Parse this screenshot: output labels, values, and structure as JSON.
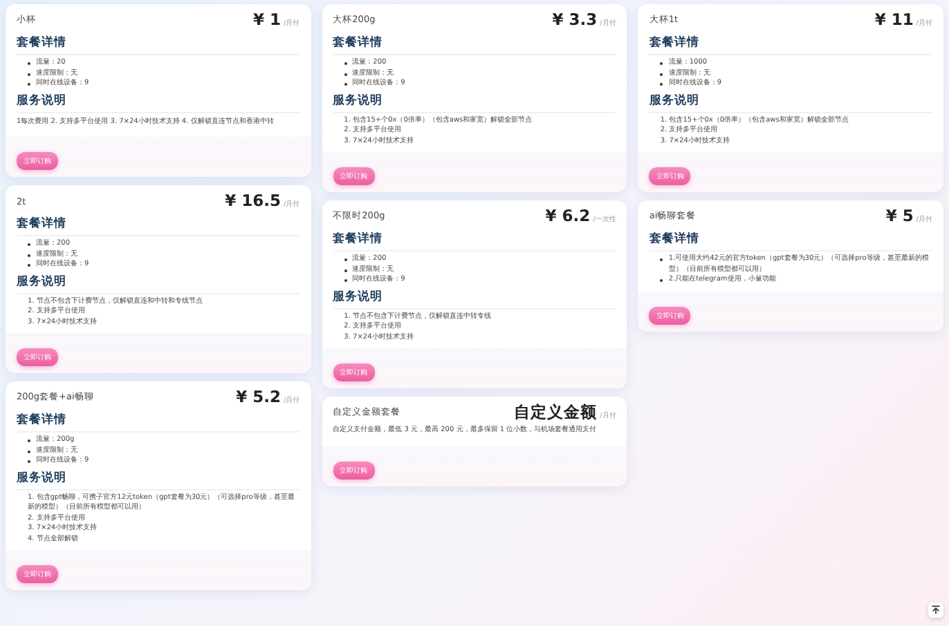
{
  "columns": [
    {
      "cards": [
        {
          "name": "小杯",
          "price": "¥ 1",
          "unit": "/月付",
          "button": "立即订购",
          "sections": [
            {
              "heading": "套餐详情",
              "kind": "bullets",
              "items": [
                "流量：20",
                "速度限制：无",
                "同时在线设备：9"
              ]
            },
            {
              "heading": "服务说明",
              "kind": "text",
              "text": "1每次费用 2. 支持多平台使用 3. 7×24小时技术支持 4. 仅解锁直连节点和香港中转"
            }
          ]
        },
        {
          "name": "2t",
          "price": "¥ 16.5",
          "unit": "/月付",
          "button": "立即订购",
          "sections": [
            {
              "heading": "套餐详情",
              "kind": "bullets",
              "items": [
                "流量：200",
                "速度限制：无",
                "同时在线设备：9"
              ]
            },
            {
              "heading": "服务说明",
              "kind": "numbered",
              "items": [
                "1. 节点不包含下计费节点，仅解锁直连和中转和专线节点",
                "2. 支持多平台使用",
                "3. 7×24小时技术支持"
              ]
            }
          ]
        },
        {
          "name": "200g套餐+ai畅聊",
          "price": "¥ 5.2",
          "unit": "/月付",
          "button": "立即订购",
          "sections": [
            {
              "heading": "套餐详情",
              "kind": "bullets",
              "items": [
                "流量：200g",
                "速度限制：无",
                "同时在线设备：9"
              ]
            },
            {
              "heading": "服务说明",
              "kind": "numbered",
              "items": [
                "1. 包含gpt畅聊，可携子官方12元token（gpt套餐为30元）（可选择pro等级，甚至最新的模型）（目前所有模型都可以用）",
                "2. 支持多平台使用",
                "3. 7×24小时技术支持",
                "4. 节点全部解锁"
              ]
            }
          ]
        }
      ]
    },
    {
      "cards": [
        {
          "name": "大杯200g",
          "price": "¥ 3.3",
          "unit": "/月付",
          "button": "立即订购",
          "sections": [
            {
              "heading": "套餐详情",
              "kind": "bullets",
              "items": [
                "流量：200",
                "速度限制：无",
                "同时在线设备：9"
              ]
            },
            {
              "heading": "服务说明",
              "kind": "numbered",
              "items": [
                "1. 包含15+个0x（0倍率）（包含aws和家宽）解锁全部节点",
                "2. 支持多平台使用",
                "3. 7×24小时技术支持"
              ]
            }
          ]
        },
        {
          "name": "不限时200g",
          "price": "¥ 6.2",
          "unit": "/一次性",
          "button": "立即订购",
          "sections": [
            {
              "heading": "套餐详情",
              "kind": "bullets",
              "items": [
                "流量：200",
                "速度限制：无",
                "同时在线设备：9"
              ]
            },
            {
              "heading": "服务说明",
              "kind": "numbered",
              "items": [
                "1. 节点不包含下计费节点，仅解锁直连中转专线",
                "2. 支持多平台使用",
                "3. 7×24小时技术支持"
              ]
            }
          ]
        },
        {
          "name": "自定义金额套餐",
          "price": "自定义金额",
          "unit": "/月付",
          "button": "立即订购",
          "sections": [
            {
              "kind": "text",
              "text": "自定义支付金额，最低 3 元，最高 200 元，最多保留 1 位小数，与机场套餐通用支付"
            }
          ]
        }
      ]
    },
    {
      "cards": [
        {
          "name": "大杯1t",
          "price": "¥ 11",
          "unit": "/月付",
          "button": "立即订购",
          "sections": [
            {
              "heading": "套餐详情",
              "kind": "bullets",
              "items": [
                "流量：1000",
                "速度限制：无",
                "同时在线设备：9"
              ]
            },
            {
              "heading": "服务说明",
              "kind": "numbered",
              "items": [
                "1. 包含15+个0x（0倍率）（包含aws和家宽）解锁全部节点",
                "2. 支持多平台使用",
                "3. 7×24小时技术支持"
              ]
            }
          ]
        },
        {
          "name": "ai畅聊套餐",
          "price": "¥ 5",
          "unit": "/月付",
          "button": "立即订购",
          "sections": [
            {
              "heading": "套餐详情",
              "kind": "bullets",
              "items": [
                "1.可使用大约42元的官方token（gpt套餐为30元）（可选择pro等级，甚至最新的模型）（目前所有模型都可以用）",
                "2.只能在telegram使用，小量功能"
              ]
            }
          ]
        }
      ]
    }
  ]
}
